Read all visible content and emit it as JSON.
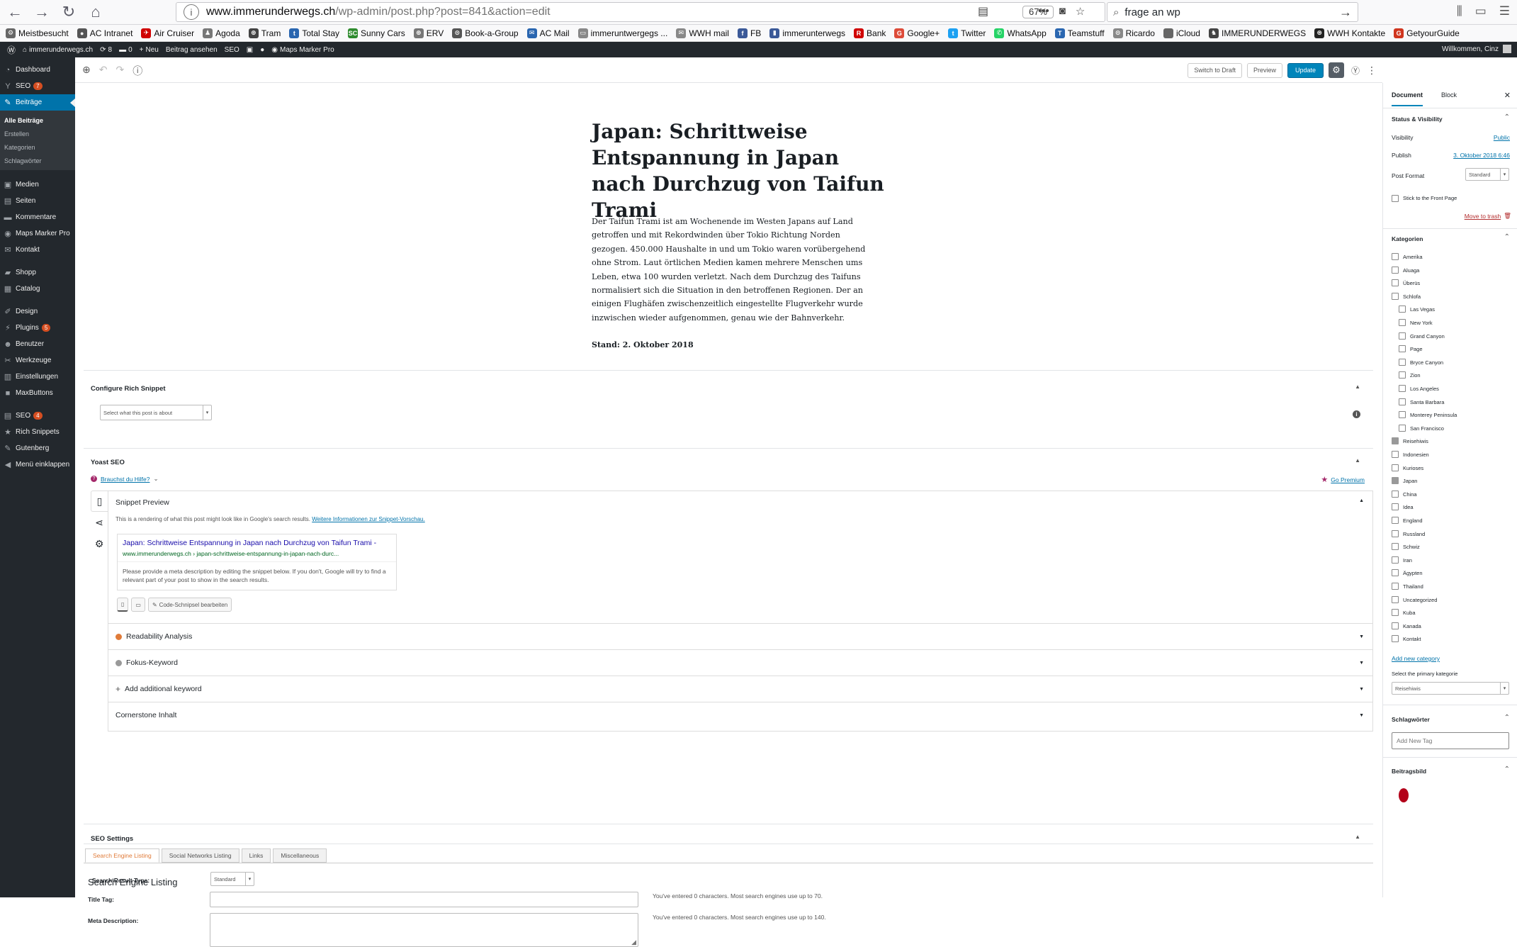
{
  "browser": {
    "url_host": "www.immerunderwegs.ch",
    "url_path": "/wp-admin/post.php?post=841&action=edit",
    "zoom": "67%",
    "search_value": "frage an wp"
  },
  "bookmarks": [
    {
      "label": "Meistbesucht",
      "color": "#666666",
      "glyph": "⚙"
    },
    {
      "label": "AC Intranet",
      "color": "#555555",
      "glyph": "●"
    },
    {
      "label": "Air Cruiser",
      "color": "#d00000",
      "glyph": "✈"
    },
    {
      "label": "Agoda",
      "color": "#777777",
      "glyph": "♟"
    },
    {
      "label": "Tram",
      "color": "#444444",
      "glyph": "⊕"
    },
    {
      "label": "Total Stay",
      "color": "#2a66b0",
      "glyph": "t"
    },
    {
      "label": "Sunny Cars",
      "color": "#2e8b2e",
      "glyph": "SC"
    },
    {
      "label": "ERV",
      "color": "#777777",
      "glyph": "⊕"
    },
    {
      "label": "Book-a-Group",
      "color": "#555555",
      "glyph": "⊙"
    },
    {
      "label": "AC Mail",
      "color": "#2a66b0",
      "glyph": "✉"
    },
    {
      "label": "immeruntwergegs ...",
      "color": "#888888",
      "glyph": "▭"
    },
    {
      "label": "WWH mail",
      "color": "#888888",
      "glyph": "✉"
    },
    {
      "label": "FB",
      "color": "#3b5998",
      "glyph": "f"
    },
    {
      "label": "immerunterwegs",
      "color": "#3b5998",
      "glyph": "▮"
    },
    {
      "label": "Bank",
      "color": "#d00000",
      "glyph": "R"
    },
    {
      "label": "Google+",
      "color": "#dd4b39",
      "glyph": "G"
    },
    {
      "label": "Twitter",
      "color": "#1da1f2",
      "glyph": "t"
    },
    {
      "label": "WhatsApp",
      "color": "#25d366",
      "glyph": "✆"
    },
    {
      "label": "Teamstuff",
      "color": "#2a66b0",
      "glyph": "T"
    },
    {
      "label": "Ricardo",
      "color": "#888888",
      "glyph": "⊙"
    },
    {
      "label": "iCloud",
      "color": "#666666",
      "glyph": ""
    },
    {
      "label": "IMMERUNDERWEGS",
      "color": "#444444",
      "glyph": "♞"
    },
    {
      "label": "WWH Kontakte",
      "color": "#222222",
      "glyph": "⊛"
    },
    {
      "label": "GetyourGuide",
      "color": "#d0361f",
      "glyph": "G"
    }
  ],
  "admin_bar": {
    "site": "immerunderwegs.ch",
    "updates": "8",
    "comments": "0",
    "new": "Neu",
    "view_post": "Beitrag ansehen",
    "seo": "SEO",
    "maps": "Maps Marker Pro",
    "welcome": "Willkommen, Cinz"
  },
  "sidebar": {
    "items": [
      {
        "label": "Dashboard",
        "icon": "dashboard-icon",
        "glyph": "◔"
      },
      {
        "label": "SEO",
        "icon": "yoast-icon",
        "glyph": "Y",
        "badge": "7"
      },
      {
        "label": "Beiträge",
        "icon": "pin-icon",
        "glyph": "✎",
        "active": true
      }
    ],
    "submenu": [
      "Alle Beiträge",
      "Erstellen",
      "Kategorien",
      "Schlagwörter"
    ],
    "items2": [
      {
        "label": "Medien",
        "icon": "media-icon",
        "glyph": "▣"
      },
      {
        "label": "Seiten",
        "icon": "pages-icon",
        "glyph": "▤"
      },
      {
        "label": "Kommentare",
        "icon": "comments-icon",
        "glyph": "▬"
      },
      {
        "label": "Maps Marker Pro",
        "icon": "map-icon",
        "glyph": "◉"
      },
      {
        "label": "Kontakt",
        "icon": "mail-icon",
        "glyph": "✉"
      }
    ],
    "items3": [
      {
        "label": "Shopp",
        "icon": "shop-icon",
        "glyph": "▰"
      },
      {
        "label": "Catalog",
        "icon": "catalog-icon",
        "glyph": "▦"
      }
    ],
    "items4": [
      {
        "label": "Design",
        "icon": "brush-icon",
        "glyph": "✐"
      },
      {
        "label": "Plugins",
        "icon": "plugin-icon",
        "glyph": "⚡",
        "badge": "5"
      },
      {
        "label": "Benutzer",
        "icon": "users-icon",
        "glyph": "☻"
      },
      {
        "label": "Werkzeuge",
        "icon": "tools-icon",
        "glyph": "✂"
      },
      {
        "label": "Einstellungen",
        "icon": "settings-icon",
        "glyph": "▥"
      },
      {
        "label": "MaxButtons",
        "icon": "maxbuttons-icon",
        "glyph": "■"
      }
    ],
    "items5": [
      {
        "label": "SEO",
        "icon": "seo-icon",
        "glyph": "▤",
        "badge": "4"
      },
      {
        "label": "Rich Snippets",
        "icon": "snippets-icon",
        "glyph": "★"
      },
      {
        "label": "Gutenberg",
        "icon": "gutenberg-icon",
        "glyph": "✎"
      },
      {
        "label": "Menü einklappen",
        "icon": "collapse-icon",
        "glyph": "◀"
      }
    ]
  },
  "header": {
    "switch_draft": "Switch to Draft",
    "preview": "Preview",
    "update": "Update"
  },
  "post": {
    "title": "Japan: Schrittweise Entspannung in Japan nach Durchzug von Taifun Trami",
    "body": "Der Taifun Trami ist am Wochenende im Westen Japans auf Land getroffen und mit Rekordwinden über Tokio Richtung Norden gezogen. 450.000 Haushalte in und um Tokio waren vorübergehend ohne Strom. Laut örtlichen Medien kamen mehrere Menschen ums Leben, etwa 100 wurden verletzt. Nach dem Durchzug des Taifuns normalisiert sich die Situation in den betroffenen Regionen. Der an einigen Flughäfen zwischenzeitlich eingestellte Flugverkehr wurde inzwischen wieder aufgenommen, genau wie der Bahnverkehr.",
    "stand": "Stand: 2. Oktober 2018"
  },
  "rich_snippet": {
    "title": "Configure Rich Snippet",
    "select": "Select what this post is about"
  },
  "yoast": {
    "title": "Yoast SEO",
    "help": "Brauchst du Hilfe?",
    "premium": "Go Premium",
    "snippet_preview": "Snippet Preview",
    "intro": "This is a rendering of what this post might look like in Google's search results.",
    "intro_link": "Weitere Informationen zur Snippet-Vorschau.",
    "snip_title": "Japan: Schrittweise Entspannung in Japan nach Durchzug von Taifun Trami -",
    "snip_url": "www.immerunderwegs.ch › japan-schrittweise-entspannung-in-japan-nach-durc...",
    "snip_desc": "Please provide a meta description by editing the snippet below. If you don't, Google will try to find a relevant part of your post to show in the search results.",
    "edit_snippet": "Code-Schnipsel bearbeiten",
    "readability": "Readability Analysis",
    "focus": "Fokus-Keyword",
    "additional": "Add additional keyword",
    "cornerstone": "Cornerstone Inhalt",
    "readability_color": "#e07b39",
    "focus_color": "#999999"
  },
  "seo_settings": {
    "title": "SEO Settings",
    "tabs": [
      "Search Engine Listing",
      "Social Networks Listing",
      "Links",
      "Miscellaneous"
    ],
    "heading": "Search Engine Listing",
    "title_tag": "Title Tag:",
    "title_note": "You've entered 0 characters. Most search engines use up to 70.",
    "meta_desc": "Meta Description:",
    "meta_note": "You've entered 0 characters. Most search engines use up to 140.",
    "result_type": "Search Result Type:",
    "result_value": "Standard"
  },
  "settings": {
    "tab_document": "Document",
    "tab_block": "Block",
    "status_title": "Status & Visibility",
    "visibility_label": "Visibility",
    "visibility_value": "Public",
    "publish_label": "Publish",
    "publish_value": "3. Oktober 2018 6:46",
    "format_label": "Post Format",
    "format_value": "Standard",
    "stick": "Stick to the Front Page",
    "trash": "Move to trash",
    "categories_title": "Kategorien",
    "categories": [
      {
        "label": "Amerika",
        "checked": false,
        "indent": false
      },
      {
        "label": "Aluaga",
        "checked": false,
        "indent": false
      },
      {
        "label": "Überüs",
        "checked": false,
        "indent": false
      },
      {
        "label": "Schlofa",
        "checked": false,
        "indent": false
      },
      {
        "label": "Las Vegas",
        "checked": false,
        "indent": true
      },
      {
        "label": "New York",
        "checked": false,
        "indent": true
      },
      {
        "label": "Grand Canyon",
        "checked": false,
        "indent": true
      },
      {
        "label": "Page",
        "checked": false,
        "indent": true
      },
      {
        "label": "Bryce Canyon",
        "checked": false,
        "indent": true
      },
      {
        "label": "Zion",
        "checked": false,
        "indent": true
      },
      {
        "label": "Los Angeles",
        "checked": false,
        "indent": true
      },
      {
        "label": "Santa Barbara",
        "checked": false,
        "indent": true
      },
      {
        "label": "Monterey Peninsula",
        "checked": false,
        "indent": true
      },
      {
        "label": "San Francisco",
        "checked": false,
        "indent": true
      },
      {
        "label": "Reisehiwis",
        "checked": true,
        "indent": false
      },
      {
        "label": "Indonesien",
        "checked": false,
        "indent": false
      },
      {
        "label": "Kurioses",
        "checked": false,
        "indent": false
      },
      {
        "label": "Japan",
        "checked": true,
        "indent": false
      },
      {
        "label": "China",
        "checked": false,
        "indent": false
      },
      {
        "label": "Idea",
        "checked": false,
        "indent": false
      },
      {
        "label": "England",
        "checked": false,
        "indent": false
      },
      {
        "label": "Russland",
        "checked": false,
        "indent": false
      },
      {
        "label": "Schwiz",
        "checked": false,
        "indent": false
      },
      {
        "label": "Iran",
        "checked": false,
        "indent": false
      },
      {
        "label": "Ägypten",
        "checked": false,
        "indent": false
      },
      {
        "label": "Thailand",
        "checked": false,
        "indent": false
      },
      {
        "label": "Uncategorized",
        "checked": false,
        "indent": false
      },
      {
        "label": "Kuba",
        "checked": false,
        "indent": false
      },
      {
        "label": "Kanada",
        "checked": false,
        "indent": false
      },
      {
        "label": "Kontakt",
        "checked": false,
        "indent": false
      }
    ],
    "add_category": "Add new category",
    "primary_label": "Select the primary kategorie",
    "primary_value": "Reisehiwis",
    "tags_title": "Schlagwörter",
    "tag_placeholder": "Add New Tag",
    "featured_title": "Beitragsbild"
  }
}
